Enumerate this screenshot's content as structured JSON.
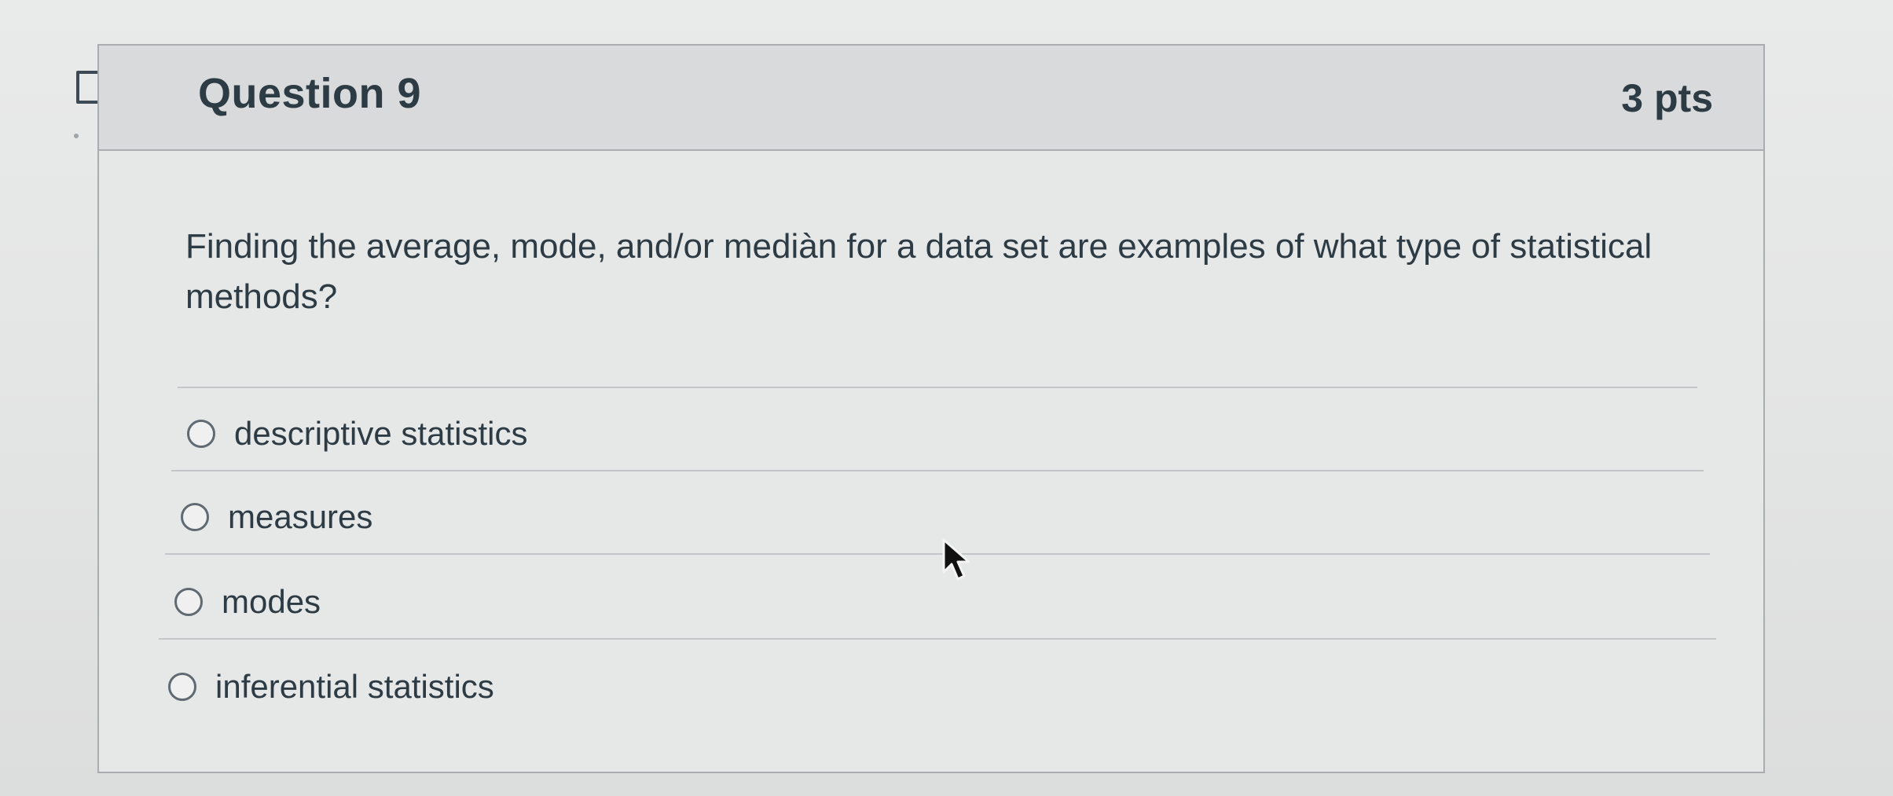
{
  "question": {
    "title": "Question 9",
    "points": "3 pts",
    "text": "Finding the average, mode, and/or mediàn for a data set are examples of what type of statistical methods?"
  },
  "answers": [
    {
      "label": "descriptive statistics",
      "selected": false
    },
    {
      "label": "measures",
      "selected": false
    },
    {
      "label": "modes",
      "selected": false
    },
    {
      "label": "inferential statistics",
      "selected": false
    }
  ],
  "icons": {
    "flag": "flag-icon",
    "cursor": "mouse-cursor-icon",
    "radio": "radio-button"
  },
  "colors": {
    "text": "#2d3b45",
    "border": "#a9adb0",
    "header_bg": "#d9dadb"
  }
}
